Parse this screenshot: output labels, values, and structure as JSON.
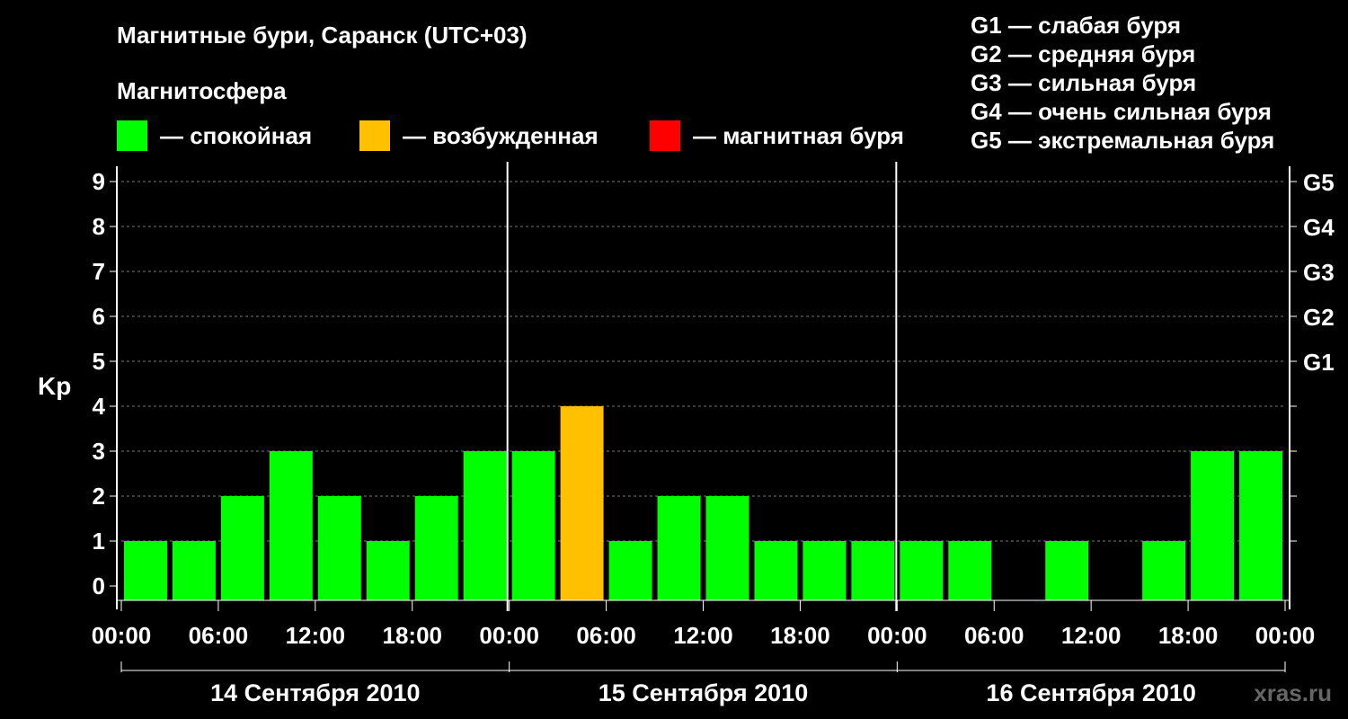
{
  "title": "Магнитные бури, Саранск (UTC+03)",
  "subtitle": "Магнитосфера",
  "legend": [
    {
      "label": "— спокойная",
      "color": "#00ff00"
    },
    {
      "label": "— возбужденная",
      "color": "#ffc000"
    },
    {
      "label": "— магнитная буря",
      "color": "#ff0000"
    }
  ],
  "g_scale": [
    "G1 — слабая буря",
    "G2 — средняя буря",
    "G3 — сильная буря",
    "G4 — очень сильная буря",
    "G5 — экстремальная буря"
  ],
  "watermark": "xras.ru",
  "chart_data": {
    "type": "bar",
    "title": "Магнитные бури, Саранск (UTC+03)",
    "ylabel": "Kp",
    "ylim": [
      0,
      9
    ],
    "yticks": [
      "0",
      "1",
      "2",
      "3",
      "4",
      "5",
      "6",
      "7",
      "8",
      "9"
    ],
    "right_ticks": [
      {
        "value": 5,
        "label": "G1"
      },
      {
        "value": 6,
        "label": "G2"
      },
      {
        "value": 7,
        "label": "G3"
      },
      {
        "value": 8,
        "label": "G4"
      },
      {
        "value": 9,
        "label": "G5"
      }
    ],
    "x_tick_labels": [
      "00:00",
      "06:00",
      "12:00",
      "18:00",
      "00:00",
      "06:00",
      "12:00",
      "18:00",
      "00:00",
      "06:00",
      "12:00",
      "18:00",
      "00:00"
    ],
    "days": [
      "14 Сентября 2010",
      "15 Сентября 2010",
      "16 Сентября 2010"
    ],
    "bar_interval_hours": 3,
    "values": [
      1,
      1,
      2,
      3,
      2,
      1,
      2,
      3,
      3,
      4,
      1,
      2,
      2,
      1,
      1,
      1,
      1,
      1,
      0,
      1,
      0,
      1,
      3,
      3
    ],
    "colors": {
      "quiet": "#00ff00",
      "disturbed": "#ffc000",
      "storm": "#ff0000"
    },
    "grid": "dashed horizontal"
  }
}
